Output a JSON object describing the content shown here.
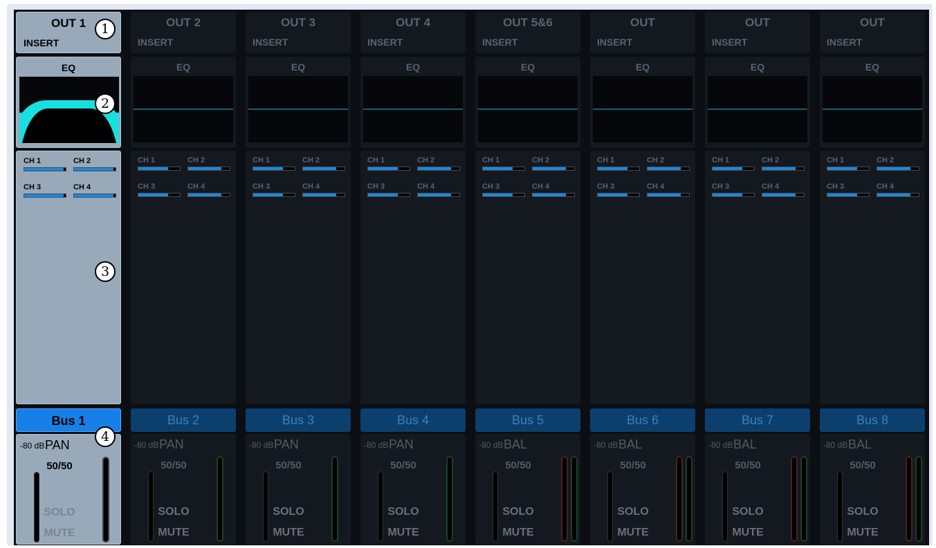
{
  "insert_label": "INSERT",
  "eq_label": "EQ",
  "send_labels": [
    "CH 1",
    "CH 2",
    "CH 3",
    "CH 4"
  ],
  "db_label": "-80 dB",
  "solo_label": "SOLO",
  "mute_label": "MUTE",
  "strips": [
    {
      "name": "OUT 1",
      "bus": "Bus 1",
      "pan_label": "PAN",
      "pan_value": "50/50",
      "selected": true,
      "stereo": false,
      "eq_curve_color": "#19e0e0",
      "send_levels": [
        0.95,
        0.95,
        0.95,
        0.95
      ]
    },
    {
      "name": "OUT 2",
      "bus": "Bus 2",
      "pan_label": "PAN",
      "pan_value": "50/50",
      "selected": false,
      "stereo": false,
      "send_levels": [
        0.72,
        0.8,
        0.72,
        0.8
      ]
    },
    {
      "name": "OUT 3",
      "bus": "Bus 3",
      "pan_label": "PAN",
      "pan_value": "50/50",
      "selected": false,
      "stereo": false,
      "send_levels": [
        0.72,
        0.8,
        0.72,
        0.8
      ]
    },
    {
      "name": "OUT 4",
      "bus": "Bus 4",
      "pan_label": "PAN",
      "pan_value": "50/50",
      "selected": false,
      "stereo": false,
      "send_levels": [
        0.72,
        0.8,
        0.72,
        0.8
      ]
    },
    {
      "name": "OUT 5&6",
      "bus": "Bus 5",
      "pan_label": "BAL",
      "pan_value": "50/50",
      "selected": false,
      "stereo": true,
      "send_levels": [
        0.72,
        0.8,
        0.72,
        0.8
      ]
    },
    {
      "name": "OUT",
      "bus": "Bus 6",
      "pan_label": "BAL",
      "pan_value": "50/50",
      "selected": false,
      "stereo": true,
      "send_levels": [
        0.72,
        0.8,
        0.72,
        0.8
      ]
    },
    {
      "name": "OUT",
      "bus": "Bus 7",
      "pan_label": "BAL",
      "pan_value": "50/50",
      "selected": false,
      "stereo": true,
      "send_levels": [
        0.72,
        0.8,
        0.72,
        0.8
      ]
    },
    {
      "name": "OUT",
      "bus": "Bus 8",
      "pan_label": "BAL",
      "pan_value": "50/50",
      "selected": false,
      "stereo": true,
      "send_levels": [
        0.72,
        0.8,
        0.72,
        0.8
      ]
    }
  ],
  "callouts": [
    "1",
    "2",
    "3",
    "4"
  ],
  "colors": {
    "bus_selected": "#1780e8",
    "bus_dim": "#0b3f6e",
    "send_fill": "#1b88d8",
    "eq_curve": "#19e0e0"
  }
}
